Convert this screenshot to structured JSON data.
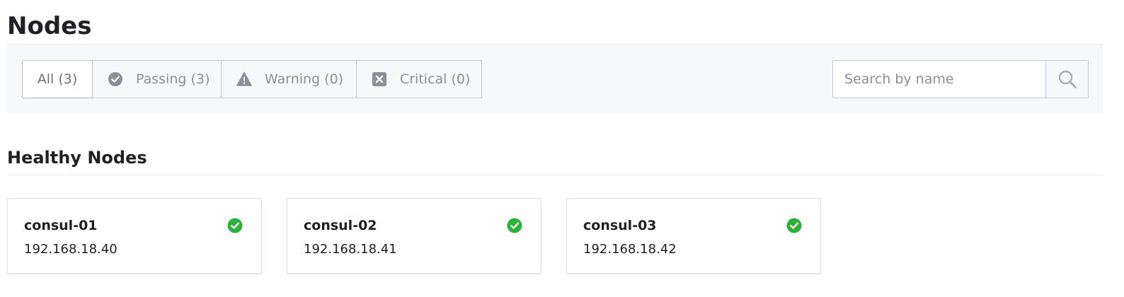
{
  "page": {
    "title": "Nodes"
  },
  "filters": {
    "tabs": [
      {
        "label": "All (3)",
        "icon": ""
      },
      {
        "label": "Passing (3)",
        "icon": "check-circle-icon"
      },
      {
        "label": "Warning (0)",
        "icon": "warning-triangle-icon"
      },
      {
        "label": "Critical (0)",
        "icon": "x-square-icon"
      }
    ],
    "active_tab": "All (3)"
  },
  "search": {
    "placeholder": "Search by name",
    "value": "",
    "icon": "search-icon"
  },
  "section": {
    "title": "Healthy Nodes"
  },
  "nodes": [
    {
      "name": "consul-01",
      "address": "192.168.18.40",
      "status_icon": "check-circle-icon"
    },
    {
      "name": "consul-02",
      "address": "192.168.18.41",
      "status_icon": "check-circle-icon"
    },
    {
      "name": "consul-03",
      "address": "192.168.18.42",
      "status_icon": "check-circle-icon"
    }
  ],
  "colors": {
    "passing": "#2eb039",
    "icon_gray": "#8a8f98",
    "text": "#1f2124",
    "bar_bg": "#f7f8fa",
    "border": "#c5c9d1"
  }
}
